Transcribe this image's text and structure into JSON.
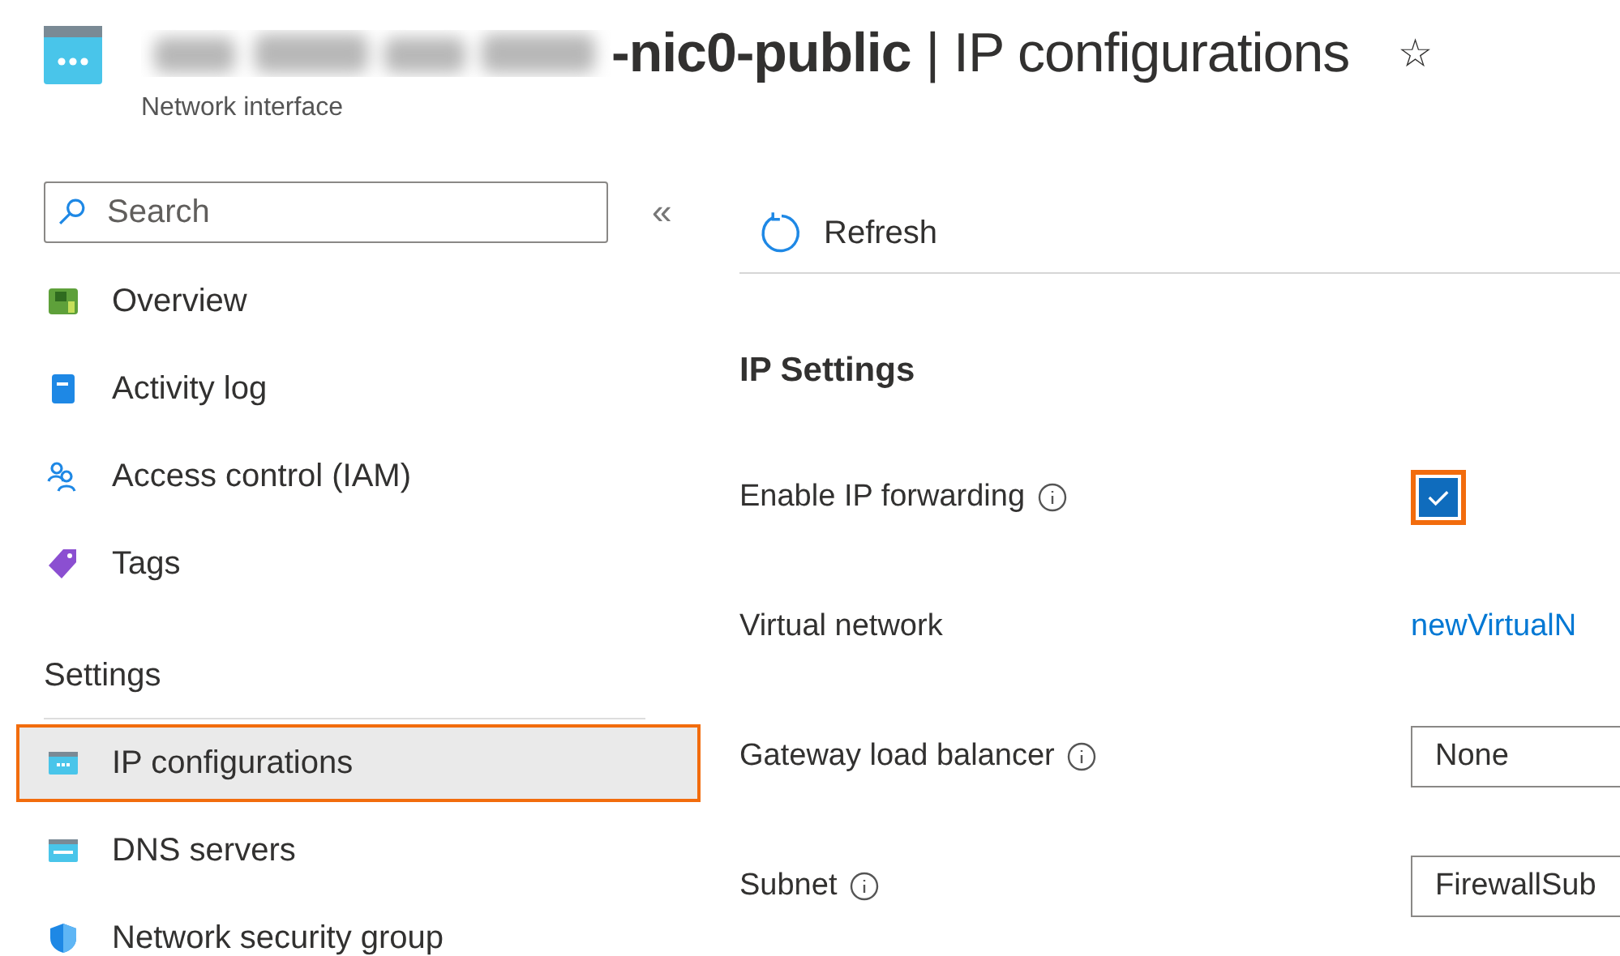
{
  "header": {
    "title": "**-nic0-public** | IP configurations",
    "subtitle": "Network interface",
    "favorite": "☆"
  },
  "sidebar": {
    "search": {
      "placeholder": "Search"
    },
    "collapse": "«",
    "items": [
      {
        "label": "Overview",
        "kind": "overview",
        "selected": false,
        "highlighted": false
      },
      {
        "label": "Activity log",
        "kind": "log",
        "selected": false,
        "highlighted": false
      },
      {
        "label": "Access control (IAM)",
        "kind": "iam",
        "selected": false,
        "highlighted": false
      },
      {
        "label": "Tags",
        "kind": "tags",
        "selected": false,
        "highlighted": false
      }
    ],
    "section": "Settings",
    "section_items": [
      {
        "label": "IP configurations",
        "kind": "nic",
        "selected": true,
        "highlighted": true
      },
      {
        "label": "DNS servers",
        "kind": "dns",
        "selected": false,
        "highlighted": false
      },
      {
        "label": "Network security group",
        "kind": "nsg",
        "selected": false,
        "highlighted": false
      }
    ]
  },
  "toolbar": {
    "refresh": "Refresh"
  },
  "form": {
    "heading": "IP Settings",
    "rows": [
      {
        "label": "Enable IP forwarding",
        "info": true,
        "kind": "checkbox",
        "checked": true,
        "highlighted": true
      },
      {
        "label": "Virtual network",
        "info": false,
        "kind": "link",
        "value": "newVirtualN"
      },
      {
        "label": "Gateway load balancer",
        "info": true,
        "kind": "select",
        "value": "None"
      },
      {
        "label": "Subnet",
        "info": true,
        "kind": "select",
        "value": "FirewallSub"
      }
    ]
  }
}
